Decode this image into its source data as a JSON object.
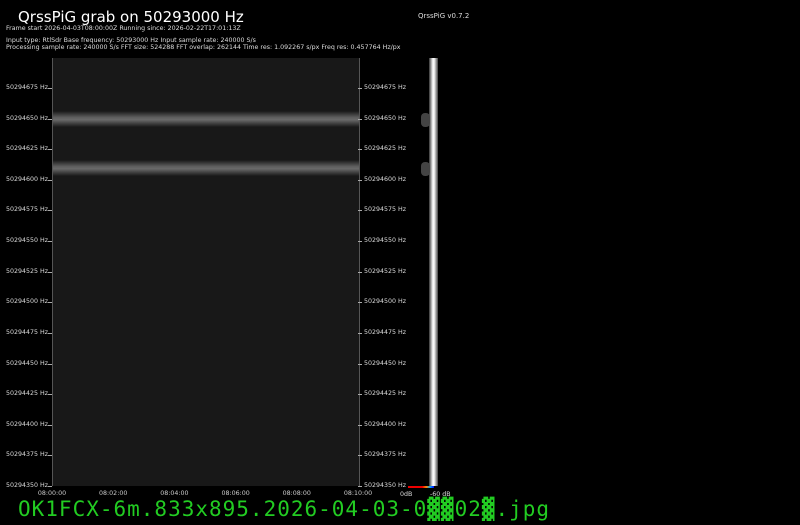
{
  "header": {
    "title": "QrssPiG grab on 50293000 Hz",
    "version": "QrssPiG v0.7.2",
    "frame_line": "Frame start 2026-04-03T08:00:00Z Running since: 2026-02-22T17:01:13Z",
    "input_line": "Input type: RtlSdr Base frequency: 50293000 Hz Input sample rate: 240000 S/s",
    "processing_line": "Processing sample rate: 240000 S/s FFT size: 524288 FFT overlap: 262144 Time res: 1.092267 s/px Freq res: 0.457764 Hz/px"
  },
  "freq_labels": [
    "50294675 Hz",
    "50294650 Hz",
    "50294625 Hz",
    "50294600 Hz",
    "50294575 Hz",
    "50294550 Hz",
    "50294525 Hz",
    "50294500 Hz",
    "50294475 Hz",
    "50294450 Hz",
    "50294425 Hz",
    "50294400 Hz",
    "50294375 Hz",
    "50294350 Hz"
  ],
  "time_labels": [
    "08:00:00",
    "08:02:00",
    "08:04:00",
    "08:06:00",
    "08:08:00",
    "08:10:00"
  ],
  "scale": {
    "min_label": "0dB",
    "max_label": "-60 dB"
  },
  "filename": "OK1FCX-6m.833x895.2026-04-03-0▓▓02▓.jpg",
  "colors": {
    "filename": "#22cc22",
    "background": "#000000"
  }
}
